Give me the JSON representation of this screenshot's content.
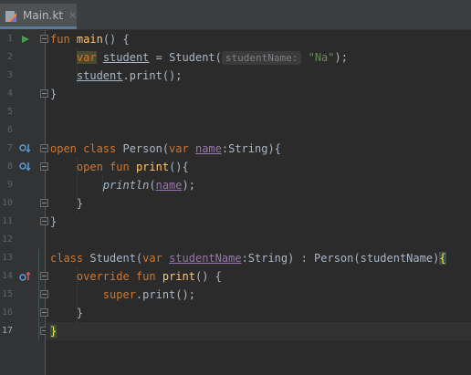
{
  "tab": {
    "file_name": "Main.kt",
    "close_symbol": "×"
  },
  "line_numbers": [
    "1",
    "2",
    "3",
    "4",
    "5",
    "6",
    "7",
    "8",
    "9",
    "10",
    "11",
    "12",
    "13",
    "14",
    "15",
    "16",
    "17"
  ],
  "code": {
    "l1": {
      "kw": "fun",
      "name": "main",
      "rest": "() {"
    },
    "l2": {
      "kw": "var",
      "var": "student",
      "eq": " = Student(",
      "hint": "studentName:",
      "str": "\"Na\"",
      "end": ");"
    },
    "l3": {
      "var": "student",
      "rest": ".print();"
    },
    "l4": {
      "brace": "}"
    },
    "l7": {
      "kw": "open class",
      "cls": " Person(",
      "kw2": "var",
      "prop": "name",
      "rest": ":String){"
    },
    "l8": {
      "kw": "open fun",
      "name": "print",
      "rest": "(){"
    },
    "l9": {
      "fn": "println",
      "open": "(",
      "prop": "name",
      "rest": ");"
    },
    "l10": {
      "brace": "}"
    },
    "l11": {
      "brace": "}"
    },
    "l13": {
      "kw": "class",
      "cls": " Student(",
      "kw2": "var",
      "prop": "studentName",
      "rest": ":String) : Person(studentName)",
      "brace": "{"
    },
    "l14": {
      "kw": "override fun",
      "name": "print",
      "rest": "() {"
    },
    "l15": {
      "kw": "super",
      "rest": ".print();"
    },
    "l16": {
      "brace": "}"
    },
    "l17": {
      "brace": "}"
    }
  },
  "colors": {
    "background": "#2b2b2b",
    "keyword": "#cc7832",
    "function": "#ffc66d",
    "string": "#6a8759",
    "property": "#9876aa",
    "text": "#a9b7c6"
  }
}
